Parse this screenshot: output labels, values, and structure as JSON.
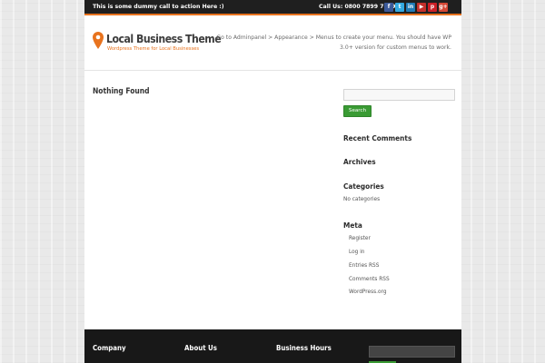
{
  "topbar": {
    "cta_text": "This is some dummy call to action Here :)",
    "call_us": "Call Us: 0800 7899 7899",
    "socials": [
      {
        "name": "facebook-icon",
        "glyph": "f",
        "color": "#3b5998"
      },
      {
        "name": "twitter-icon",
        "glyph": "t",
        "color": "#33a9e0"
      },
      {
        "name": "linkedin-icon",
        "glyph": "in",
        "color": "#1f7bb6"
      },
      {
        "name": "youtube-icon",
        "glyph": "▶",
        "color": "#c4302b"
      },
      {
        "name": "pinterest-icon",
        "glyph": "p",
        "color": "#cb2027"
      },
      {
        "name": "googleplus-icon",
        "glyph": "g+",
        "color": "#d34836"
      }
    ]
  },
  "header": {
    "site_title": "Local Business Theme",
    "tagline": "Wordpress Theme for Local Businesses",
    "menu_note": "Go to Adminpanel > Appearance > Menus to create your menu. You should have WP 3.0+ version for custom menus to work."
  },
  "main": {
    "heading": "Nothing Found"
  },
  "sidebar": {
    "search_button": "Search",
    "recent_comments_title": "Recent Comments",
    "archives_title": "Archives",
    "categories_title": "Categories",
    "categories_empty": "No categories",
    "meta_title": "Meta",
    "meta_links": [
      "Register",
      "Log in",
      "Entries RSS",
      "Comments RSS",
      "WordPress.org"
    ]
  },
  "footer": {
    "company_title": "Company",
    "about_title": "About Us",
    "hours_title": "Business Hours"
  },
  "colors": {
    "accent": "#e8731e",
    "button_green": "#3a9b34",
    "topbar_bg": "#1f1f1f",
    "footer_bg": "#181818"
  }
}
